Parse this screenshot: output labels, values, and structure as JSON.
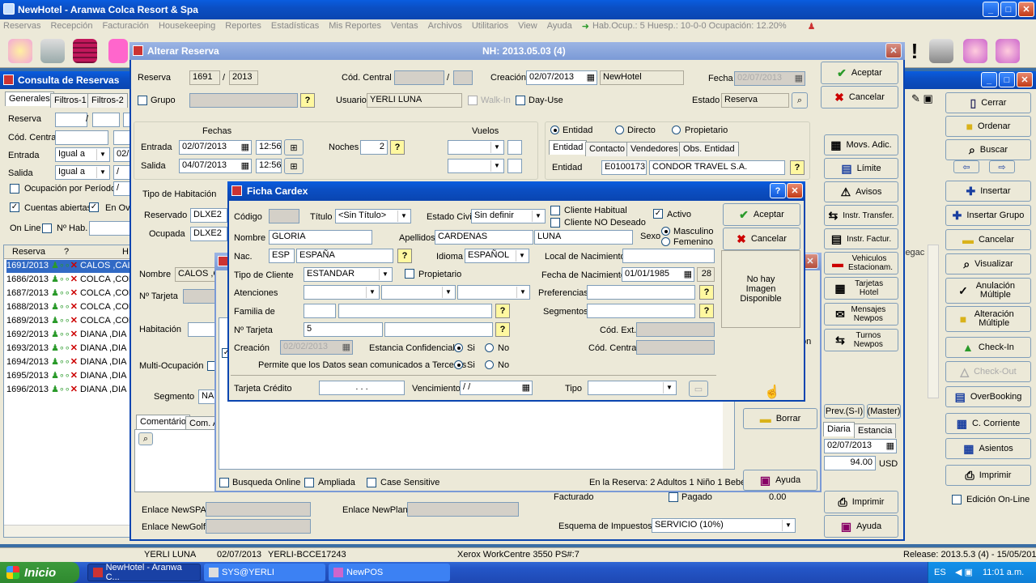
{
  "app": {
    "title": "NewHotel - Aranwa Colca Resort & Spa",
    "menu": [
      "Reservas",
      "Recepción",
      "Facturación",
      "Housekeeping",
      "Reportes",
      "Estadísticas",
      "Mis Reportes",
      "Ventas",
      "Archivos",
      "Utilitarios",
      "View",
      "Ayuda"
    ],
    "occupancy": "Hab.Ocup.: 5 Huesp.: 10-0-0 Ocupación: 12.20%"
  },
  "consulta": {
    "title": "Consulta de Reservas",
    "tabs": [
      "Generales",
      "Filtros-1",
      "Filtros-2"
    ],
    "labels": {
      "reserva": "Reserva",
      "cod_central": "Cód. Central",
      "entrada": "Entrada",
      "salida": "Salida",
      "ocupacion": "Ocupación por Período",
      "cuentas": "Cuentas abiertas",
      "en_ov": "En Ov",
      "online": "On Line",
      "nhab": "Nº Hab."
    },
    "entrada_op": "Igual a",
    "salida_op": "Igual a",
    "entrada_val": "02/",
    "col_reserva": "Reserva",
    "col_q": "?",
    "col_h": "H",
    "rows": [
      {
        "id": "1691/2013",
        "name": "CALOS ,CAL"
      },
      {
        "id": "1686/2013",
        "name": "COLCA ,COL"
      },
      {
        "id": "1687/2013",
        "name": "COLCA ,COL"
      },
      {
        "id": "1688/2013",
        "name": "COLCA ,COL"
      },
      {
        "id": "1689/2013",
        "name": "COLCA ,COL"
      },
      {
        "id": "1692/2013",
        "name": "DIANA ,DIA"
      },
      {
        "id": "1693/2013",
        "name": "DIANA ,DIA"
      },
      {
        "id": "1694/2013",
        "name": "DIANA ,DIA"
      },
      {
        "id": "1695/2013",
        "name": "DIANA ,DIA"
      },
      {
        "id": "1696/2013",
        "name": "DIANA ,DIA"
      }
    ]
  },
  "alterar": {
    "title": "Alterar Reserva",
    "nh": "NH: 2013.05.03 (4)",
    "reserva_lbl": "Reserva",
    "reserva_num": "1691",
    "reserva_year": "2013",
    "cod_central_lbl": "Cód. Central",
    "creacion_lbl": "Creación",
    "creacion": "02/07/2013",
    "creacion_user": "NewHotel",
    "fecha_lbl": "Fecha",
    "fecha": "02/07/2013",
    "grupo_lbl": "Grupo",
    "usuario_lbl": "Usuario",
    "usuario": "YERLI LUNA",
    "walkin_lbl": "Walk-In",
    "dayuse_lbl": "Day-Use",
    "estado_lbl": "Estado",
    "estado": "Reserva",
    "fechas_lbl": "Fechas",
    "entrada_lbl": "Entrada",
    "entrada": "02/07/2013",
    "entrada_h": "12:56",
    "salida_lbl": "Salida",
    "salida": "04/07/2013",
    "salida_h": "12:56",
    "noches_lbl": "Noches",
    "noches": "2",
    "vuelos_lbl": "Vuelos",
    "entidad_r": "Entidad",
    "directo_r": "Directo",
    "propietario_r": "Propietario",
    "tabs": [
      "Entidad",
      "Contacto",
      "Vendedores",
      "Obs. Entidad"
    ],
    "entidad_lbl": "Entidad",
    "entidad_code": "E0100173",
    "entidad_name": "CONDOR TRAVEL S.A.",
    "tipo_hab_lbl": "Tipo de Habitación",
    "reservado_lbl": "Reservado",
    "reservado": "DLXE2",
    "ocupada_lbl": "Ocupada",
    "ocupada": "DLXE2",
    "nombre_lbl": "Nombre",
    "nombre": "CALOS ,C",
    "ntarjeta_lbl": "Nº Tarjeta",
    "habitacion_lbl": "Habitación",
    "multi_lbl": "Multi-Ocupación",
    "segmento_lbl": "Segmento",
    "segmento": "NA",
    "comentario_tab": "Comentário",
    "com_tab": "Com. A",
    "enlace_spa": "Enlace NewSPA",
    "enlace_plan": "Enlace NewPlan",
    "enlace_golf": "Enlace NewGolf",
    "facturado_lbl": "Facturado",
    "pagado_lbl": "Pagado",
    "pagado_val": "0.00",
    "esquema_lbl": "Esquema de Impuestos",
    "esquema": "SERVICIO (10%)",
    "prev": "Prev.(S-I)",
    "master": "(Master)",
    "diaria_tab": "Diaria",
    "estancia_tab": "Estancia",
    "diaria_fecha": "02/07/2013",
    "diaria_val": "94.00",
    "currency": "USD"
  },
  "alterar_buttons": {
    "aceptar": "Aceptar",
    "cancelar": "Cancelar",
    "movs": "Movs. Adic.",
    "limite": "Límite",
    "avisos": "Avisos",
    "transfer": "Instr. Transfer.",
    "factur": "Instr. Factur.",
    "vehiculos": "Vehiculos Estacionam.",
    "tarjetas": "Tarjetas Hotel",
    "mensajes": "Mensajes Newpos",
    "turnos": "Turnos Newpos",
    "borrar": "Borrar",
    "ayuda": "Ayuda",
    "imprimir": "Imprimir",
    "ayuda2": "Ayuda"
  },
  "right_buttons": [
    "Cerrar",
    "Ordenar",
    "Buscar",
    "Insertar",
    "Insertar Grupo",
    "Cancelar",
    "Visualizar",
    "Anulación Múltiple",
    "Alteración Múltiple",
    "Check-In",
    "Check-Out",
    "OverBooking",
    "C. Corriente",
    "Asientos",
    "Imprimir"
  ],
  "edicion_online": "Edición On-Line",
  "cardex": {
    "title": "Ficha Cardex",
    "codigo_lbl": "Código",
    "titulo_lbl": "Título",
    "titulo": "<Sin Título>",
    "estado_civil_lbl": "Estado Civil",
    "estado_civil": "Sin definir",
    "cliente_habitual": "Cliente Habitual",
    "cliente_no_deseado": "Cliente NO Deseado",
    "activo": "Activo",
    "nombre_lbl": "Nombre",
    "nombre": "GLORIA",
    "apellidos_lbl": "Apellidos",
    "apellido1": "CARDENAS",
    "apellido2": "LUNA",
    "sexo_lbl": "Sexo",
    "masculino": "Masculino",
    "femenino": "Femenino",
    "nac_lbl": "Nac.",
    "nac_code": "ESP",
    "nac_name": "ESPAÑA",
    "idioma_lbl": "Idioma",
    "idioma": "ESPAÑOL",
    "local_nac_lbl": "Local de Nacimiento",
    "tipo_cliente_lbl": "Tipo de Cliente",
    "tipo_cliente": "ESTANDAR",
    "propietario_lbl": "Propietario",
    "fecha_nac_lbl": "Fecha de Nacimiento",
    "fecha_nac": "01/01/1985",
    "edad": "28",
    "atenciones_lbl": "Atenciones",
    "preferencias_lbl": "Preferencias",
    "familia_lbl": "Familia de",
    "segmentos_lbl": "Segmentos",
    "ntarjeta_lbl": "Nº Tarjeta",
    "ntarjeta": "5",
    "cod_ext_lbl": "Cód. Ext.",
    "creacion_lbl": "Creación",
    "creacion": "02/02/2013",
    "estancia_conf_lbl": "Estancia Confidencial",
    "si": "Si",
    "no": "No",
    "cod_central_lbl": "Cód. Central",
    "permite_lbl": "Permite que los Datos sean comunicados a Terceros",
    "tarjeta_credito_lbl": "Tarjeta Crédito",
    "tarjeta_credito": ". . .",
    "vencimiento_lbl": "Vencimiento",
    "vencimiento": "/ /",
    "tipo_lbl": "Tipo",
    "aceptar": "Aceptar",
    "cancelar": "Cancelar",
    "no_image": "No hay Imagen Disponible"
  },
  "busqueda": {
    "online": "Busqueda Online",
    "ampliada": "Ampliada",
    "case": "Case Sensitive",
    "en_reserva": "En la Reserva: 2 Adultos 1 Niño 1 Bebé",
    "ayuda": "Ayuda",
    "on": "on"
  },
  "status": {
    "user": "YERLI LUNA",
    "date": "02/07/2013",
    "session": "YERLI-BCCE17243",
    "printer": "Xerox WorkCentre 3550 PS#:7",
    "release": "Release: 2013.5.3 (4) - 15/05/2013"
  },
  "taskbar": {
    "start": "Inicio",
    "items": [
      "NewHotel - Aranwa C...",
      "SYS@YERLI",
      "NewPOS"
    ],
    "lang": "ES",
    "time": "11:01 a.m."
  }
}
